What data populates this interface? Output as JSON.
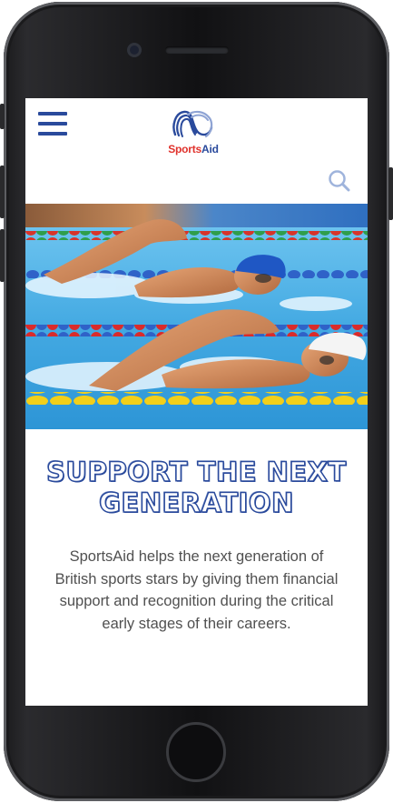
{
  "header": {
    "menu_icon": "hamburger-menu-icon",
    "logo": {
      "word_part1": "Sports",
      "word_part2": "Aid",
      "icon": "sportsaid-swirl-logo",
      "colors": {
        "red": "#e0322c",
        "blue": "#2a4a9c"
      }
    },
    "search_icon": "search-icon"
  },
  "hero": {
    "subject": "two swimmers racing freestyle in a pool with lane ropes"
  },
  "main": {
    "headline": [
      "SUPPORT THE NEXT",
      "GENERATION"
    ],
    "description": "SportsAid helps the next generation of British sports stars by giving them financial support and recognition during the critical early stages of their careers."
  },
  "colors": {
    "accent": "#2a4a9c",
    "text": "#505050",
    "lane_blue": "#2f62c8",
    "lane_yellow": "#f2cf1a",
    "water": "#4eb1e6"
  }
}
